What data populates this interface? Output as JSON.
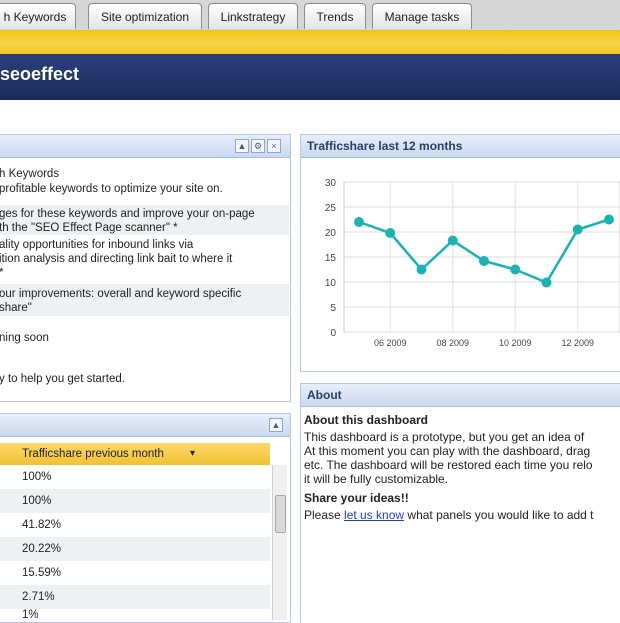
{
  "tabs": [
    {
      "label": "h Keywords"
    },
    {
      "label": "Site optimization"
    },
    {
      "label": "Linkstrategy"
    },
    {
      "label": "Trends"
    },
    {
      "label": "Manage tasks"
    }
  ],
  "app": {
    "title": "seoeffect"
  },
  "steps_panel": {
    "lines": [
      "h Keywords",
      " profitable keywords to optimize your site on.",
      "ges for these keywords and improve your on-page",
      "th the \"SEO Effect Page scanner\" *",
      "ality opportunities for inbound links via",
      "ition analysis and directing link bait to where it",
      " *",
      "our improvements: overall and keyword specific",
      "share\"",
      "ning soon",
      "y to help you get started."
    ]
  },
  "table_panel": {
    "header": "Trafficshare previous month",
    "sort_indicator": "▾",
    "values": [
      "100%",
      "100%",
      "41.82%",
      "20.22%",
      "15.59%",
      "2.71%",
      "1%"
    ]
  },
  "chart_panel": {
    "title": "Trafficshare last 12 months"
  },
  "chart_data": {
    "type": "line",
    "x_tick_labels": [
      "06 2009",
      "08 2009",
      "10 2009",
      "12 2009"
    ],
    "x": [
      "05 2009",
      "06 2009",
      "07 2009",
      "08 2009",
      "09 2009",
      "10 2009",
      "11 2009",
      "12 2009",
      "01 2010"
    ],
    "y_ticks": [
      0,
      5,
      10,
      15,
      20,
      25,
      30
    ],
    "ylim": [
      0,
      30
    ],
    "series": [
      {
        "values": [
          22,
          19.8,
          12.5,
          18.3,
          14.2,
          12.5,
          9.9,
          20.5,
          22.5
        ]
      }
    ],
    "grid": true,
    "line_color": "#19b3b3"
  },
  "about_panel": {
    "title": "About",
    "heading": "About this dashboard",
    "line1": "This dashboard is a prototype, but you get an idea of",
    "line2": "At this moment you can play with the dashboard, drag",
    "line3": "etc. The dashboard will be restored each time you relo",
    "line4": "it will be fully customizable.",
    "share_heading": "Share your ideas!!",
    "share_prefix": "Please ",
    "share_link": "let us know",
    "share_suffix": " what panels you would like to add t"
  },
  "icons": {
    "collapse": "▲",
    "settings": "⚙",
    "close": "×"
  },
  "colors": {
    "header_navy": "#1b2c5c",
    "gold": "#f3c316",
    "chart_line": "#19b3b3"
  }
}
